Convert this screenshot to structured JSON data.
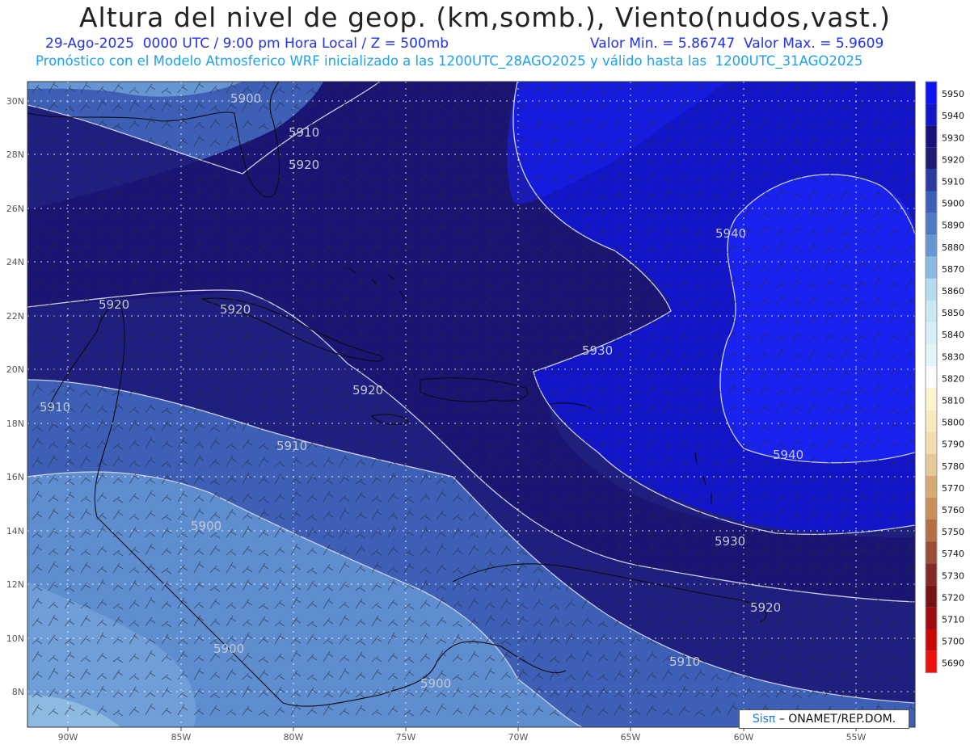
{
  "header": {
    "title": "Altura del nivel de geop. (km,somb.), Viento(nudos,vast.)",
    "line1_left": "29-Ago-2025  0000 UTC / 9:00 pm Hora Local / Z = 500mb",
    "line1_right": "Valor Min. = 5.86747  Valor Max. = 5.9609",
    "line2": "Pronóstico con el Modelo Atmosferico WRF inicializado a las 1200UTC_28AGO2025 y válido hasta las  1200UTC_31AGO2025"
  },
  "map": {
    "lat_labels": [
      "30N",
      "28N",
      "26N",
      "24N",
      "22N",
      "20N",
      "18N",
      "16N",
      "14N",
      "12N",
      "10N",
      "8N"
    ],
    "lon_labels": [
      "90W",
      "85W",
      "80W",
      "75W",
      "70W",
      "65W",
      "60W",
      "55W"
    ],
    "contour_labels": [
      "5900",
      "5910",
      "5920",
      "5920",
      "5920",
      "5930",
      "5920",
      "5910",
      "5910",
      "5900",
      "5940",
      "5940",
      "5930",
      "5920",
      "5910",
      "5900",
      "5900"
    ],
    "shading_colors": {
      "level_5900": "#5f8ed0",
      "level_5910": "#3d5fb6",
      "level_5920": "#1f1f80",
      "level_5930": "#1a1473",
      "level_5940": "#1315c8",
      "level_5950": "#1a22f0"
    }
  },
  "colorbar": {
    "levels": [
      "5950",
      "5940",
      "5930",
      "5920",
      "5910",
      "5900",
      "5890",
      "5880",
      "5870",
      "5860",
      "5850",
      "5840",
      "5830",
      "5820",
      "5810",
      "5800",
      "5790",
      "5780",
      "5770",
      "5760",
      "5750",
      "5740",
      "5730",
      "5720",
      "5710",
      "5700",
      "5690"
    ],
    "colors": [
      "#1010f5",
      "#1515c8",
      "#16127a",
      "#1c1c76",
      "#2b3aa0",
      "#3d5fb6",
      "#4d78c4",
      "#6596d2",
      "#8cbae0",
      "#b8dcef",
      "#c8e8f4",
      "#d6eff8",
      "#e2f5fb",
      "#ffffff",
      "#fdf3cf",
      "#f9e8bd",
      "#f1ddb0",
      "#e6c99a",
      "#d6aa74",
      "#c78f5a",
      "#b27044",
      "#9a4d34",
      "#842828",
      "#741216",
      "#9e0a0e",
      "#c80808",
      "#ec1010"
    ]
  },
  "credit": {
    "brand": "Sisπ",
    "org": "– ONAMET/REP.DOM."
  }
}
